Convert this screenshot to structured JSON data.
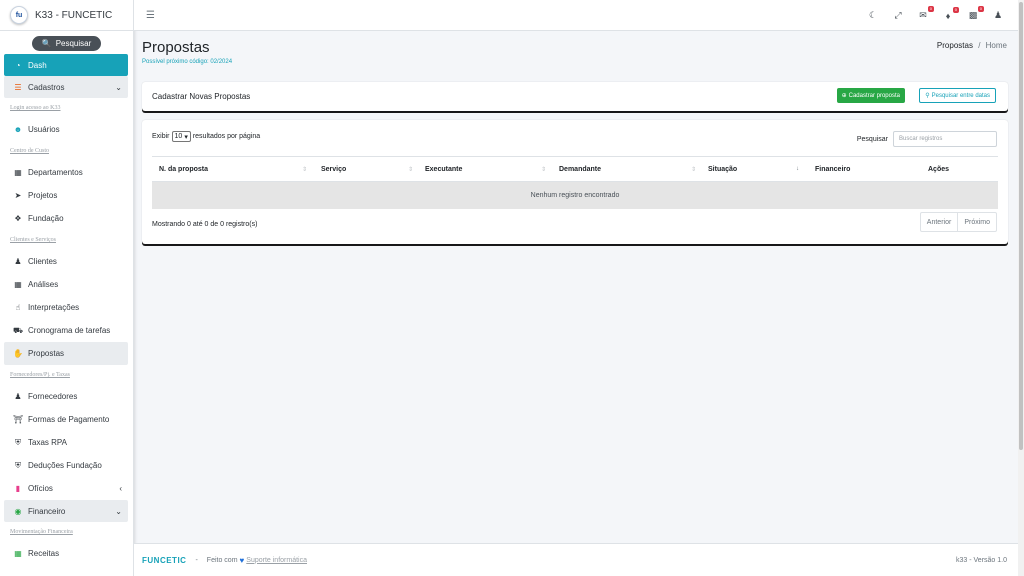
{
  "brand": {
    "logo": "fu",
    "title": "K33 - FUNCETIC"
  },
  "sidebar": {
    "search_label": "Pesquisar",
    "items": [
      {
        "label": "Dash",
        "icon": "dashboard-icon"
      },
      {
        "label": "Cadastros",
        "icon": "list-icon"
      },
      {
        "header": "Login acesso ao K33"
      },
      {
        "label": "Usuários",
        "icon": "user-icon"
      },
      {
        "header": "Centro de Custo"
      },
      {
        "label": "Departamentos",
        "icon": "building-icon"
      },
      {
        "label": "Projetos",
        "icon": "rocket-icon"
      },
      {
        "label": "Fundação",
        "icon": "handshake-icon"
      },
      {
        "header": "Clientes e Serviços"
      },
      {
        "label": "Clientes",
        "icon": "users-icon"
      },
      {
        "label": "Análises",
        "icon": "grid-icon"
      },
      {
        "label": "Interpretações",
        "icon": "hand-icon"
      },
      {
        "label": "Cronograma de tarefas",
        "icon": "truck-icon"
      },
      {
        "label": "Propostas",
        "icon": "hand-coin-icon"
      },
      {
        "header": "Fornecedores/Pj. e Taxas"
      },
      {
        "label": "Fornecedores",
        "icon": "users-cog-icon"
      },
      {
        "label": "Formas de Pagamento",
        "icon": "bank-icon"
      },
      {
        "label": "Taxas RPA",
        "icon": "shield-icon"
      },
      {
        "label": "Deduções Fundação",
        "icon": "shield-icon"
      },
      {
        "label": "Ofícios",
        "icon": "file-icon"
      },
      {
        "label": "Financeiro",
        "icon": "money-bag-icon"
      },
      {
        "header": "Movimentação Financeira"
      },
      {
        "label": "Receitas",
        "icon": "money-icon"
      }
    ]
  },
  "page": {
    "title": "Propostas",
    "subtitle": "Possível próximo código: 02/2024",
    "breadcrumb_current": "Propostas",
    "breadcrumb_sep": "/",
    "breadcrumb_home": "Home"
  },
  "card1": {
    "title": "Cadastrar Novas Propostas",
    "btn_new": "Cadastrar proposta",
    "btn_search": "Pesquisar entre datas"
  },
  "table": {
    "show_label": "Exibir",
    "show_value": "10",
    "show_suffix": "resultados por página",
    "search_label": "Pesquisar",
    "search_placeholder": "Buscar registros",
    "columns": [
      "N. da proposta",
      "Serviço",
      "Executante",
      "Demandante",
      "Situação",
      "Financeiro",
      "Ações"
    ],
    "empty": "Nenhum registro encontrado",
    "info": "Mostrando 0 até 0 de 0 registro(s)",
    "prev": "Anterior",
    "next": "Próximo"
  },
  "footer": {
    "brand": "FUNCETIC",
    "sep": "-",
    "made_with": "Feito com",
    "link": "Suporte informática",
    "version": "k33 - Versão 1.0"
  },
  "topbar": {
    "badges": [
      "0",
      "0",
      "0"
    ]
  }
}
